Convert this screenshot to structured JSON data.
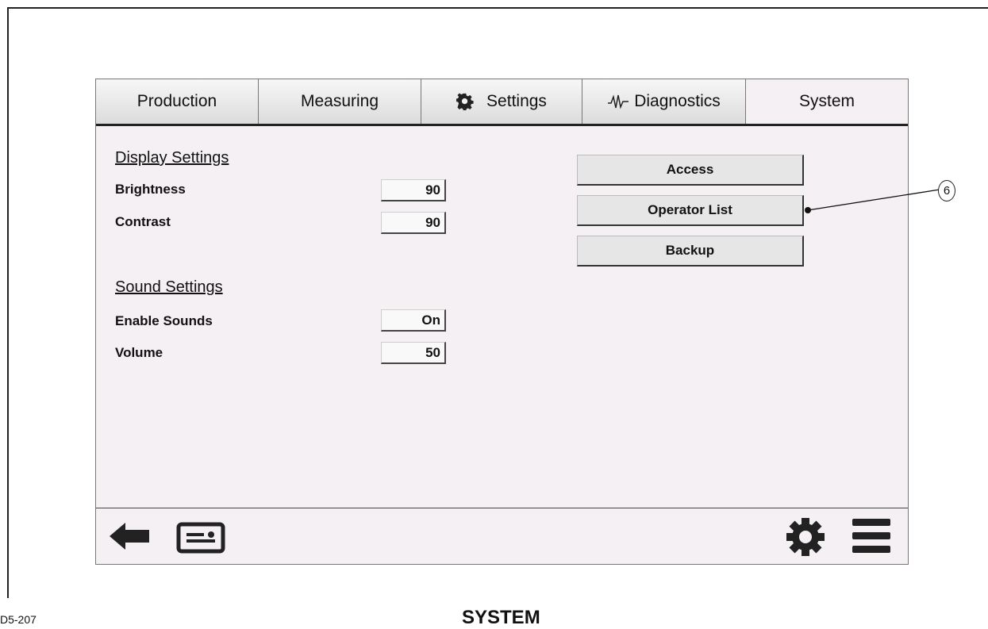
{
  "tabs": [
    {
      "label": "Production",
      "icon": null,
      "active": false
    },
    {
      "label": "Measuring",
      "icon": null,
      "active": false
    },
    {
      "label": "Settings",
      "icon": "gear-icon",
      "active": false
    },
    {
      "label": "Diagnostics",
      "icon": "waveform-icon",
      "active": false
    },
    {
      "label": "System",
      "icon": null,
      "active": true
    }
  ],
  "display_settings": {
    "heading": "Display Settings",
    "brightness_label": "Brightness",
    "brightness_value": "90",
    "contrast_label": "Contrast",
    "contrast_value": "90"
  },
  "sound_settings": {
    "heading": "Sound Settings",
    "enable_label": "Enable Sounds",
    "enable_value": "On",
    "volume_label": "Volume",
    "volume_value": "50"
  },
  "buttons": {
    "access": "Access",
    "operator_list": "Operator List",
    "backup": "Backup"
  },
  "footer_icons": [
    "back-arrow-icon",
    "id-card-icon",
    "gear-icon",
    "menu-icon"
  ],
  "callout": "6",
  "figure_id": "D5-207",
  "caption": "SYSTEM"
}
